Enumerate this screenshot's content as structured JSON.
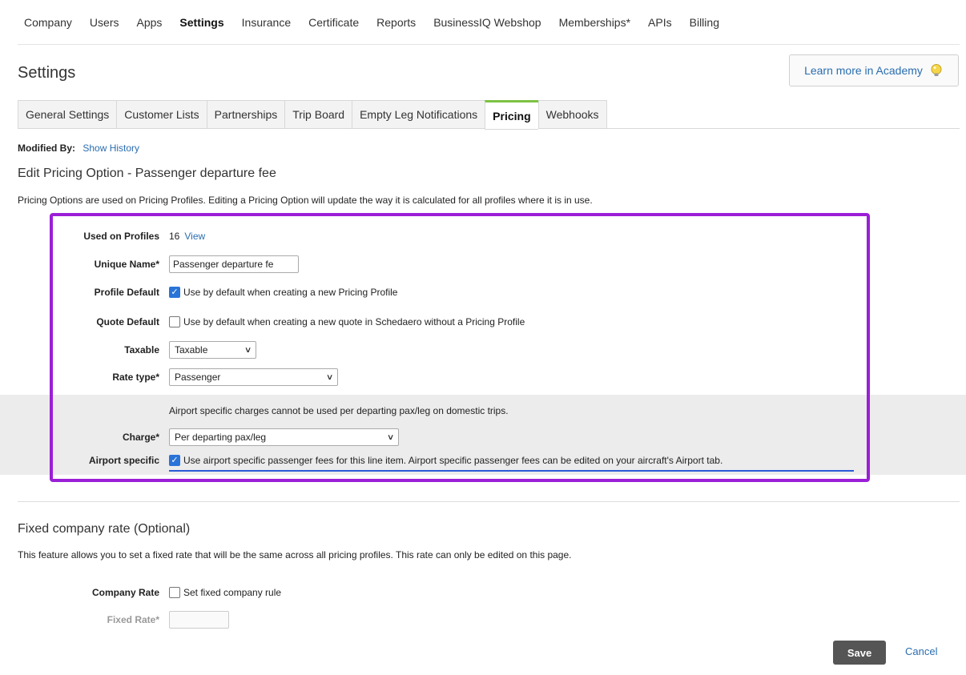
{
  "topnav": {
    "items": [
      "Company",
      "Users",
      "Apps",
      "Settings",
      "Insurance",
      "Certificate",
      "Reports",
      "BusinessIQ Webshop",
      "Memberships*",
      "APIs",
      "Billing"
    ],
    "active": "Settings"
  },
  "page": {
    "title": "Settings",
    "academy_label": "Learn more in Academy"
  },
  "subtabs": {
    "items": [
      "General Settings",
      "Customer Lists",
      "Partnerships",
      "Trip Board",
      "Empty Leg Notifications",
      "Pricing",
      "Webhooks"
    ],
    "active": "Pricing"
  },
  "modified": {
    "label": "Modified By:",
    "link": "Show History"
  },
  "edit": {
    "title": "Edit Pricing Option - Passenger departure fee",
    "description": "Pricing Options are used on Pricing Profiles. Editing a Pricing Option will update the way it is calculated for all profiles where it is in use."
  },
  "form": {
    "used_on_profiles": {
      "label": "Used on Profiles",
      "count": "16",
      "link": "View"
    },
    "unique_name": {
      "label": "Unique Name*",
      "value": "Passenger departure fe"
    },
    "profile_default": {
      "label": "Profile Default",
      "checked": true,
      "text": "Use by default when creating a new Pricing Profile"
    },
    "quote_default": {
      "label": "Quote Default",
      "checked": false,
      "text": "Use by default when creating a new quote in Schedaero without a Pricing Profile"
    },
    "taxable": {
      "label": "Taxable",
      "value": "Taxable"
    },
    "rate_type": {
      "label": "Rate type*",
      "value": "Passenger"
    },
    "airport_note": "Airport specific charges cannot be used per departing pax/leg on domestic trips.",
    "charge": {
      "label": "Charge*",
      "value": "Per departing pax/leg"
    },
    "airport_specific": {
      "label": "Airport specific",
      "checked": true,
      "text": "Use airport specific passenger fees for this line item. Airport specific passenger fees can be edited on your aircraft's Airport tab."
    }
  },
  "fixed": {
    "title": "Fixed company rate (Optional)",
    "description": "This feature allows you to set a fixed rate that will be the same across all pricing profiles. This rate can only be edited on this page.",
    "company_rate": {
      "label": "Company Rate",
      "checked": false,
      "text": "Set fixed company rule"
    },
    "fixed_rate": {
      "label": "Fixed Rate*",
      "value": ""
    }
  },
  "actions": {
    "save": "Save",
    "cancel": "Cancel"
  },
  "colors": {
    "accent_green": "#7cc242",
    "highlight_purple": "#9b1fd6",
    "link_blue": "#2a6db0",
    "checkbox_blue": "#2a73d8"
  }
}
